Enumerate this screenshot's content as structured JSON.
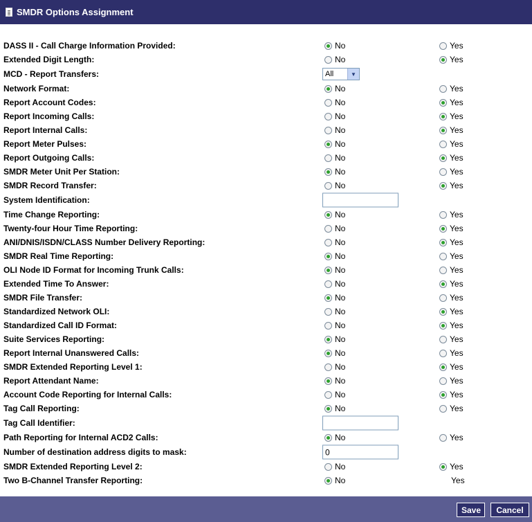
{
  "window": {
    "title": "SMDR Options Assignment"
  },
  "options": {
    "no_label": "No",
    "yes_label": "Yes"
  },
  "rows": [
    {
      "label": "DASS II - Call Charge Information Provided:",
      "kind": "radio",
      "value": "No"
    },
    {
      "label": "Extended Digit Length:",
      "kind": "radio",
      "value": "Yes"
    },
    {
      "label": "MCD - Report Transfers:",
      "kind": "select",
      "value": "All"
    },
    {
      "label": "Network Format:",
      "kind": "radio",
      "value": "No"
    },
    {
      "label": "Report Account Codes:",
      "kind": "radio",
      "value": "Yes"
    },
    {
      "label": "Report Incoming Calls:",
      "kind": "radio",
      "value": "Yes"
    },
    {
      "label": "Report Internal Calls:",
      "kind": "radio",
      "value": "Yes"
    },
    {
      "label": "Report Meter Pulses:",
      "kind": "radio",
      "value": "No"
    },
    {
      "label": "Report Outgoing Calls:",
      "kind": "radio",
      "value": "Yes"
    },
    {
      "label": "SMDR Meter Unit Per Station:",
      "kind": "radio",
      "value": "No"
    },
    {
      "label": "SMDR Record Transfer:",
      "kind": "radio",
      "value": "Yes"
    },
    {
      "label": "System Identification:",
      "kind": "text",
      "value": ""
    },
    {
      "label": "Time Change Reporting:",
      "kind": "radio",
      "value": "No"
    },
    {
      "label": "Twenty-four Hour Time Reporting:",
      "kind": "radio",
      "value": "Yes"
    },
    {
      "label": "ANI/DNIS/ISDN/CLASS Number Delivery Reporting:",
      "kind": "radio",
      "value": "Yes"
    },
    {
      "label": "SMDR Real Time Reporting:",
      "kind": "radio",
      "value": "No"
    },
    {
      "label": "OLI Node ID Format for Incoming Trunk Calls:",
      "kind": "radio",
      "value": "No"
    },
    {
      "label": "Extended Time To Answer:",
      "kind": "radio",
      "value": "Yes"
    },
    {
      "label": "SMDR File Transfer:",
      "kind": "radio",
      "value": "No"
    },
    {
      "label": "Standardized Network OLI:",
      "kind": "radio",
      "value": "Yes"
    },
    {
      "label": "Standardized Call ID Format:",
      "kind": "radio",
      "value": "Yes"
    },
    {
      "label": "Suite Services Reporting:",
      "kind": "radio",
      "value": "No"
    },
    {
      "label": "Report Internal Unanswered Calls:",
      "kind": "radio",
      "value": "No"
    },
    {
      "label": "SMDR Extended Reporting Level 1:",
      "kind": "radio",
      "value": "Yes"
    },
    {
      "label": "Report Attendant Name:",
      "kind": "radio",
      "value": "No"
    },
    {
      "label": "Account Code Reporting for Internal Calls:",
      "kind": "radio",
      "value": "Yes"
    },
    {
      "label": "Tag Call Reporting:",
      "kind": "radio",
      "value": "No"
    },
    {
      "label": "Tag Call Identifier:",
      "kind": "text",
      "value": ""
    },
    {
      "label": "Path Reporting for Internal ACD2 Calls:",
      "kind": "radio",
      "value": "No"
    },
    {
      "label": "Number of destination address digits to mask:",
      "kind": "text",
      "value": "0"
    },
    {
      "label": "SMDR Extended Reporting Level 2:",
      "kind": "radio",
      "value": "Yes"
    },
    {
      "label": "Two B-Channel Transfer Reporting:",
      "kind": "radio-yes-text",
      "value": "No"
    }
  ],
  "footer": {
    "save_label": "Save",
    "cancel_label": "Cancel"
  }
}
